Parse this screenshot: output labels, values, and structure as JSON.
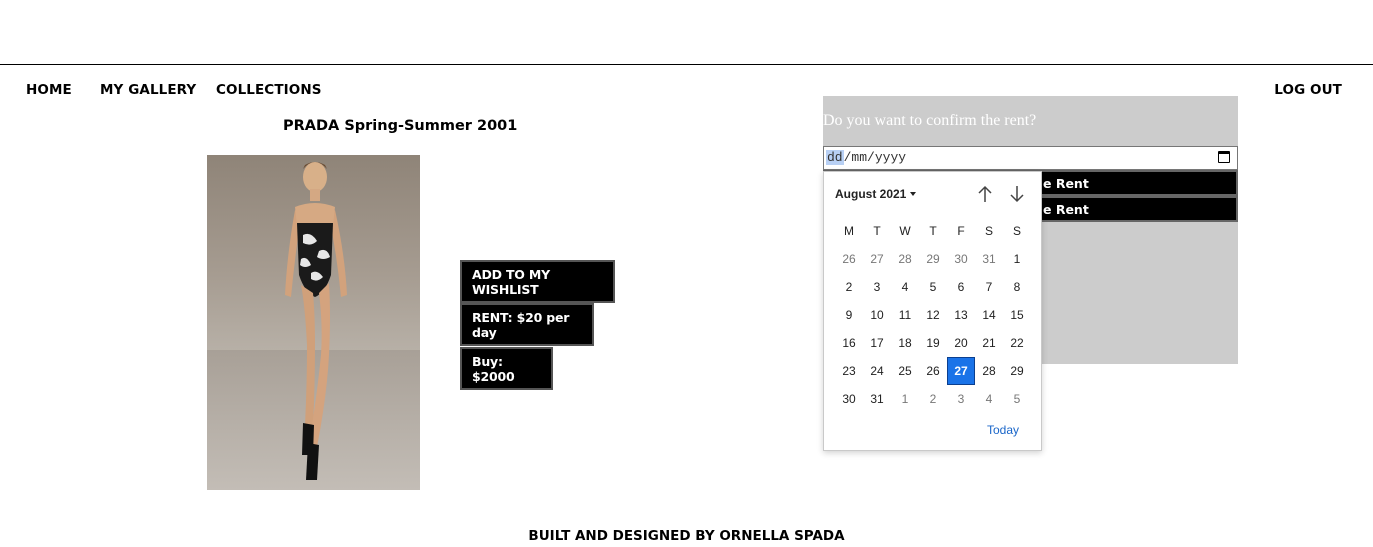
{
  "nav": {
    "home": "HOME",
    "gallery": "MY GALLERY",
    "collections": "COLLECTIONS",
    "logout": "LOG OUT"
  },
  "item": {
    "title": "PRADA Spring-Summer 2001"
  },
  "actions": {
    "wishlist": "ADD TO MY WISHLIST",
    "rent": "RENT: $20 per day",
    "buy": "Buy: $2000"
  },
  "confirm": {
    "question": "Do you want to confirm the rent?",
    "date_placeholder": {
      "dd": "dd",
      "mm": "mm",
      "yyyy": "yyyy",
      "sep": "/"
    },
    "button_1_visible_text": "e Rent",
    "button_2_visible_text": "e Rent"
  },
  "calendar": {
    "month_label": "August 2021",
    "weekdays": [
      "M",
      "T",
      "W",
      "T",
      "F",
      "S",
      "S"
    ],
    "weeks": [
      [
        {
          "d": "26",
          "m": true
        },
        {
          "d": "27",
          "m": true
        },
        {
          "d": "28",
          "m": true
        },
        {
          "d": "29",
          "m": true
        },
        {
          "d": "30",
          "m": true
        },
        {
          "d": "31",
          "m": true
        },
        {
          "d": "1",
          "m": false
        }
      ],
      [
        {
          "d": "2",
          "m": false
        },
        {
          "d": "3",
          "m": false
        },
        {
          "d": "4",
          "m": false
        },
        {
          "d": "5",
          "m": false
        },
        {
          "d": "6",
          "m": false
        },
        {
          "d": "7",
          "m": false
        },
        {
          "d": "8",
          "m": false
        }
      ],
      [
        {
          "d": "9",
          "m": false
        },
        {
          "d": "10",
          "m": false
        },
        {
          "d": "11",
          "m": false
        },
        {
          "d": "12",
          "m": false
        },
        {
          "d": "13",
          "m": false
        },
        {
          "d": "14",
          "m": false
        },
        {
          "d": "15",
          "m": false
        }
      ],
      [
        {
          "d": "16",
          "m": false
        },
        {
          "d": "17",
          "m": false
        },
        {
          "d": "18",
          "m": false
        },
        {
          "d": "19",
          "m": false
        },
        {
          "d": "20",
          "m": false
        },
        {
          "d": "21",
          "m": false
        },
        {
          "d": "22",
          "m": false
        }
      ],
      [
        {
          "d": "23",
          "m": false
        },
        {
          "d": "24",
          "m": false
        },
        {
          "d": "25",
          "m": false
        },
        {
          "d": "26",
          "m": false
        },
        {
          "d": "27",
          "m": false,
          "selected": true
        },
        {
          "d": "28",
          "m": false
        },
        {
          "d": "29",
          "m": false
        }
      ],
      [
        {
          "d": "30",
          "m": false
        },
        {
          "d": "31",
          "m": false
        },
        {
          "d": "1",
          "m": true
        },
        {
          "d": "2",
          "m": true
        },
        {
          "d": "3",
          "m": true
        },
        {
          "d": "4",
          "m": true
        },
        {
          "d": "5",
          "m": true
        }
      ]
    ],
    "today_label": "Today",
    "selected_color": "#1a73e8"
  },
  "footer": {
    "credit": "BUILT AND DESIGNED BY ORNELLA SPADA"
  },
  "colors": {
    "panel_bg": "#cccccc",
    "button_bg": "#000000"
  }
}
